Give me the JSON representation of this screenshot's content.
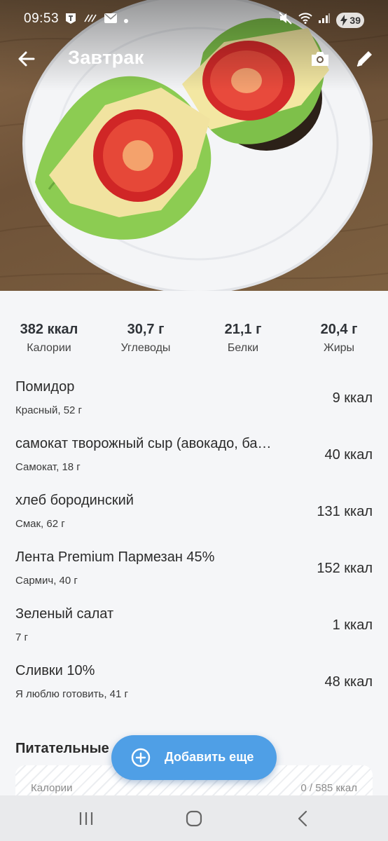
{
  "status_bar": {
    "time": "09:53",
    "battery": "39"
  },
  "app_bar": {
    "title": "Завтрак"
  },
  "macros": [
    {
      "value": "382 ккал",
      "label": "Калории"
    },
    {
      "value": "30,7 г",
      "label": "Углеводы"
    },
    {
      "value": "21,1 г",
      "label": "Белки"
    },
    {
      "value": "20,4 г",
      "label": "Жиры"
    }
  ],
  "foods": [
    {
      "name": "Помидор",
      "sub": "Красный, 52 г",
      "kcal": "9 ккал"
    },
    {
      "name": "самокат творожный сыр (авокадо, ба…",
      "sub": "Самокат, 18 г",
      "kcal": "40 ккал"
    },
    {
      "name": "хлеб бородинский",
      "sub": "Смак, 62 г",
      "kcal": "131 ккал"
    },
    {
      "name": "Лента Premium Пармезан 45%",
      "sub": "Сармич, 40 г",
      "kcal": "152 ккал"
    },
    {
      "name": "Зеленый салат",
      "sub": "7 г",
      "kcal": "1 ккал"
    },
    {
      "name": "Сливки 10%",
      "sub": "Я люблю готовить, 41 г",
      "kcal": "48 ккал"
    }
  ],
  "nutrients": {
    "title": "Питательные",
    "row_label": "Калории",
    "row_value": "0 / 585 ккал"
  },
  "add_button": {
    "label": "Добавить еще"
  },
  "colors": {
    "accent": "#4f9fe6",
    "background": "#f5f6f8",
    "nav_bar": "#e9eaec"
  }
}
